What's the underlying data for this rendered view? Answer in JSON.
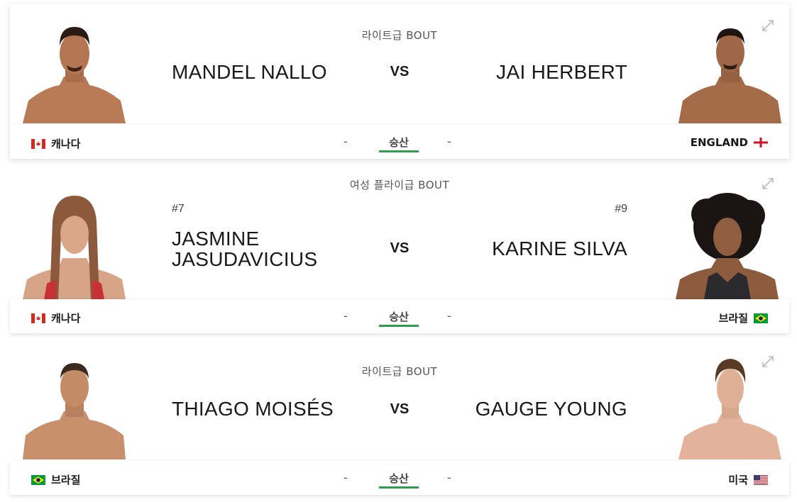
{
  "fights": [
    {
      "weight_class": "라이트급 BOUT",
      "red": {
        "name": "MANDEL NALLO",
        "rank": "",
        "country": "캐나다",
        "flag": "canada"
      },
      "blue": {
        "name": "JAI HERBERT",
        "rank": "",
        "country": "ENGLAND",
        "flag": "england"
      },
      "vs": "VS",
      "result": "승산",
      "dash": "-"
    },
    {
      "weight_class": "여성 플라이급 BOUT",
      "red": {
        "name": "JASMINE JASUDAVICIUS",
        "rank": "#7",
        "country": "캐나다",
        "flag": "canada"
      },
      "blue": {
        "name": "KARINE SILVA",
        "rank": "#9",
        "country": "브라질",
        "flag": "brazil"
      },
      "vs": "VS",
      "result": "승산",
      "dash": "-"
    },
    {
      "weight_class": "라이트급 BOUT",
      "red": {
        "name": "THIAGO MOISÉS",
        "rank": "",
        "country": "브라질",
        "flag": "brazil"
      },
      "blue": {
        "name": "GAUGE YOUNG",
        "rank": "",
        "country": "미국",
        "flag": "usa"
      },
      "vs": "VS",
      "result": "승산",
      "dash": "-"
    }
  ],
  "colors": {
    "result_underline": "#2f9e4f",
    "canada_red": "#d52b1e",
    "brazil_green": "#009c3b",
    "brazil_yellow": "#ffdf00",
    "usa_blue": "#3c3b6e"
  },
  "icons": {
    "expand": "expand-arrows-icon"
  }
}
